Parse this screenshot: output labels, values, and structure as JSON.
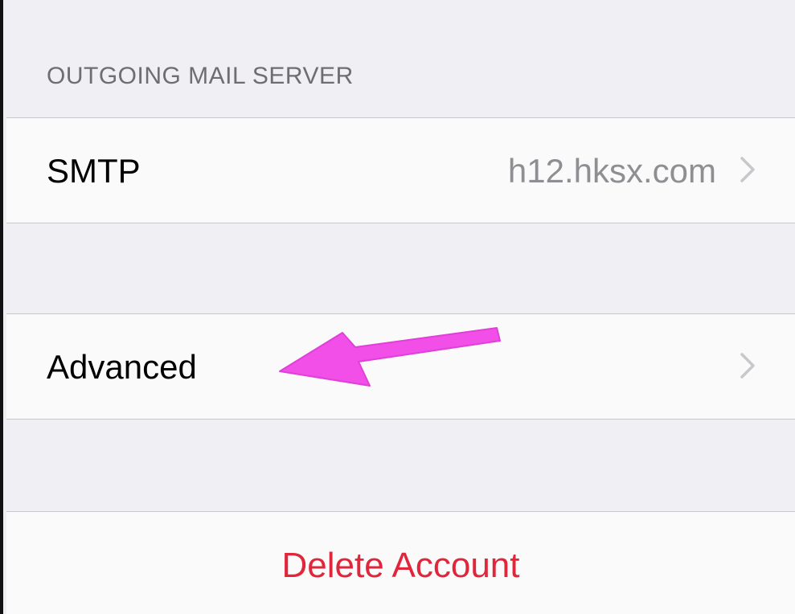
{
  "sections": {
    "outgoing_header": "OUTGOING MAIL SERVER"
  },
  "smtp": {
    "label": "SMTP",
    "value": "h12.hksx.com"
  },
  "advanced": {
    "label": "Advanced"
  },
  "delete": {
    "label": "Delete Account"
  },
  "icons": {
    "chevron": "chevron-right-icon",
    "annotation": "arrow-annotation"
  },
  "colors": {
    "background": "#efeff4",
    "cell": "#fafafa",
    "separator": "#c8c7cc",
    "header_text": "#6d6d72",
    "value_text": "#8e8e93",
    "destructive": "#e0263b",
    "arrow": "#f24ee8"
  }
}
